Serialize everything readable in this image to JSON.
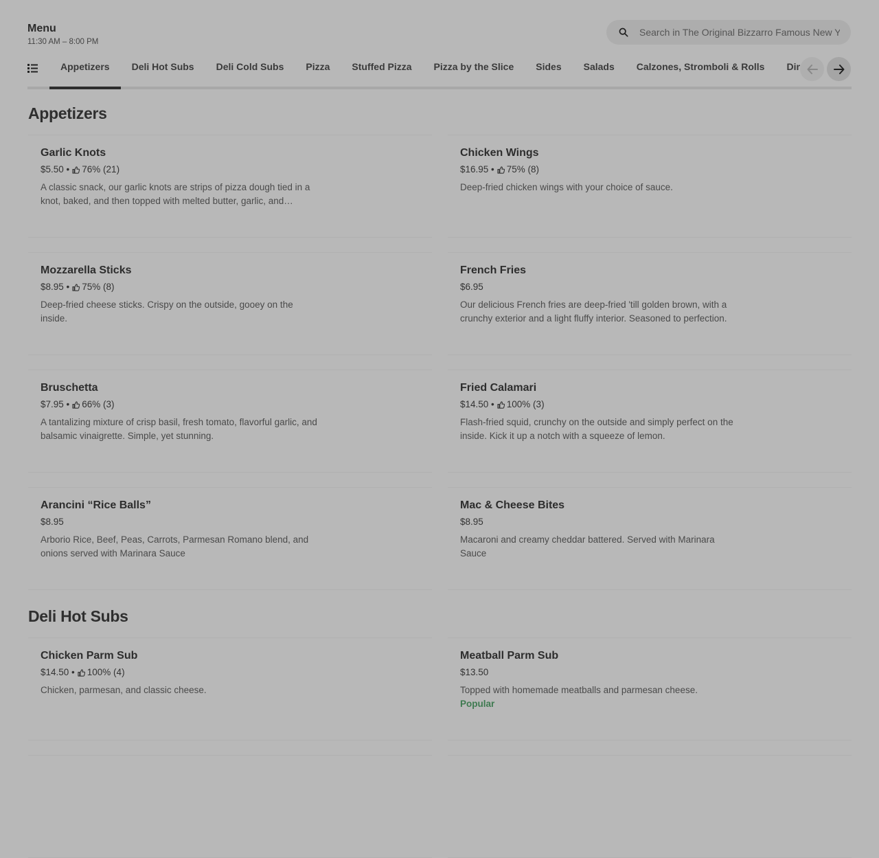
{
  "header": {
    "title": "Menu",
    "hours": "11:30 AM – 8:00 PM"
  },
  "search": {
    "placeholder": "Search in The Original Bizzarro Famous New York Pizzeria"
  },
  "tabs": [
    {
      "label": "Appetizers",
      "active": true
    },
    {
      "label": "Deli Hot Subs"
    },
    {
      "label": "Deli Cold Subs"
    },
    {
      "label": "Pizza"
    },
    {
      "label": "Stuffed Pizza"
    },
    {
      "label": "Pizza by the Slice"
    },
    {
      "label": "Sides"
    },
    {
      "label": "Salads"
    },
    {
      "label": "Calzones, Stromboli & Rolls"
    },
    {
      "label": "Dinners"
    }
  ],
  "sections": [
    {
      "title": "Appetizers",
      "items": [
        {
          "name": "Garlic Knots",
          "price": "$5.50",
          "rating": "76% (21)",
          "description": "A classic snack, our garlic knots are strips of pizza dough tied in a knot, baked, and then topped with melted butter, garlic, and parmesan."
        },
        {
          "name": "Chicken Wings",
          "price": "$16.95",
          "rating": "75% (8)",
          "description": "Deep-fried chicken wings with your choice of sauce."
        },
        {
          "name": "Mozzarella Sticks",
          "price": "$8.95",
          "rating": "75% (8)",
          "description": "Deep-fried cheese sticks. Crispy on the outside, gooey on the inside."
        },
        {
          "name": "French Fries",
          "price": "$6.95",
          "rating": "",
          "description": "Our delicious French fries are deep-fried 'till golden brown, with a crunchy exterior and a light fluffy interior. Seasoned to perfection."
        },
        {
          "name": "Bruschetta",
          "price": "$7.95",
          "rating": "66% (3)",
          "description": "A tantalizing mixture of crisp basil, fresh tomato, flavorful garlic, and balsamic vinaigrette. Simple, yet stunning."
        },
        {
          "name": "Fried Calamari",
          "price": "$14.50",
          "rating": "100% (3)",
          "description": "Flash-fried squid, crunchy on the outside and simply perfect on the inside. Kick it up a notch with a squeeze of lemon."
        },
        {
          "name": "Arancini “Rice Balls”",
          "price": "$8.95",
          "rating": "",
          "description": "Arborio Rice, Beef, Peas, Carrots, Parmesan Romano blend, and onions served with Marinara Sauce"
        },
        {
          "name": "Mac & Cheese Bites",
          "price": "$8.95",
          "rating": "",
          "description": "Macaroni and creamy cheddar battered. Served with Marinara Sauce"
        }
      ]
    },
    {
      "title": "Deli Hot Subs",
      "items": [
        {
          "name": "Chicken Parm Sub",
          "price": "$14.50",
          "rating": "100% (4)",
          "description": "Chicken, parmesan, and classic cheese."
        },
        {
          "name": "Meatball Parm Sub",
          "price": "$13.50",
          "rating": "",
          "description": "Topped with homemade meatballs and parmesan cheese.",
          "badge": "Popular"
        }
      ]
    }
  ],
  "colors": {
    "overlay_bg": "#b8b8b8",
    "popular_badge": "#3e7a50"
  }
}
